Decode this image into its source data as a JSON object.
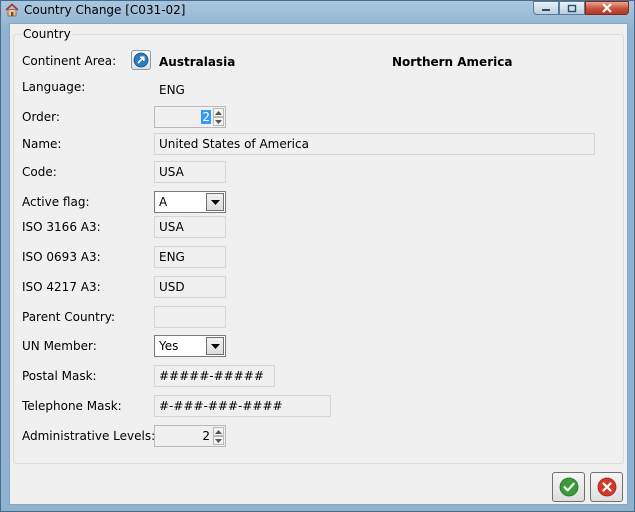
{
  "window": {
    "title": "Country Change [C031-02]"
  },
  "group": {
    "legend": "Country"
  },
  "continent": {
    "label": "Continent Area:",
    "current": "Australasia",
    "new": "Northern America",
    "button_icon": "globe-arrow-icon"
  },
  "language": {
    "label": "Language:",
    "value": "ENG"
  },
  "order": {
    "label": "Order:",
    "value": "2"
  },
  "name": {
    "label": "Name:",
    "value": "United States of America"
  },
  "code": {
    "label": "Code:",
    "value": "USA"
  },
  "active_flag": {
    "label": "Active flag:",
    "value": "A"
  },
  "iso3166": {
    "label": "ISO 3166 A3:",
    "value": "USA"
  },
  "iso0693": {
    "label": "ISO 0693 A3:",
    "value": "ENG"
  },
  "iso4217": {
    "label": "ISO 4217 A3:",
    "value": "USD"
  },
  "parent_country": {
    "label": "Parent Country:",
    "value": ""
  },
  "un_member": {
    "label": "UN Member:",
    "value": "Yes"
  },
  "postal_mask": {
    "label": "Postal Mask:",
    "value": "#####-#####"
  },
  "telephone_mask": {
    "label": "Telephone Mask:",
    "value": "#-###-###-####"
  },
  "admin_levels": {
    "label": "Administrative Levels:",
    "value": "2"
  },
  "footer": {
    "ok_icon": "checkmark-icon",
    "cancel_icon": "cancel-x-icon"
  },
  "colors": {
    "ok_green": "#3d9a3b",
    "cancel_red": "#d2392b",
    "selection_blue": "#3399ff"
  }
}
